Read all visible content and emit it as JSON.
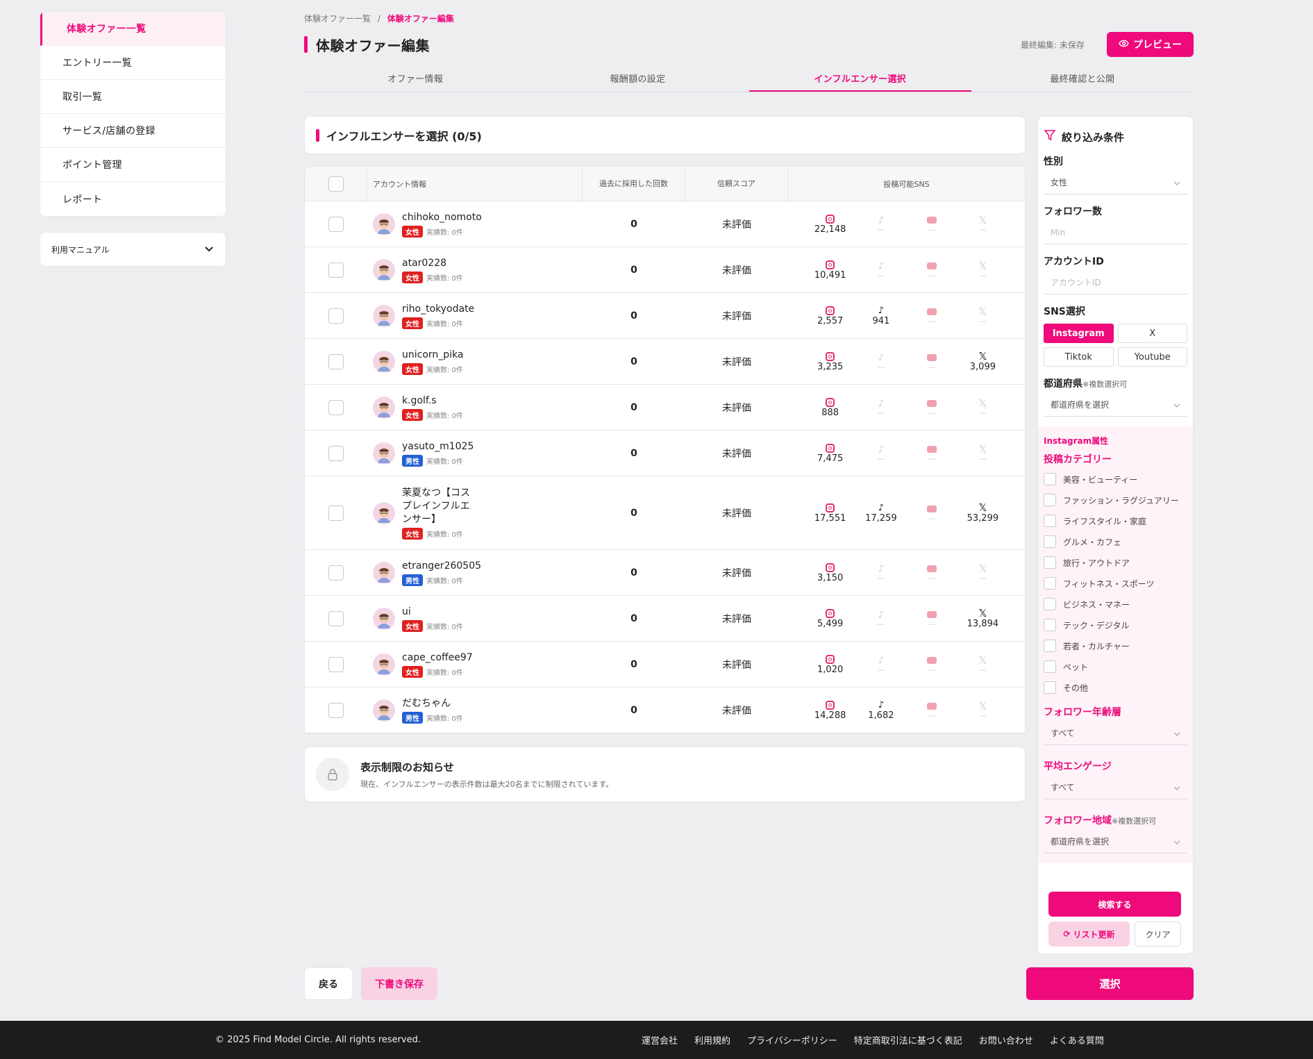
{
  "sidebar": {
    "items": [
      {
        "label": "体験オファー一覧",
        "active": true
      },
      {
        "label": "エントリー一覧"
      },
      {
        "label": "取引一覧"
      },
      {
        "label": "サービス/店舗の登録"
      },
      {
        "label": "ポイント管理"
      },
      {
        "label": "レポート"
      }
    ],
    "manual": "利用マニュアル"
  },
  "breadcrumb": {
    "parent": "体験オファー一覧",
    "sep": "/",
    "current": "体験オファー編集"
  },
  "page": {
    "title": "体験オファー編集",
    "last_edit": "最終編集: 未保存",
    "preview": "プレビュー"
  },
  "tabs": [
    "オファー情報",
    "報酬額の設定",
    "インフルエンサー選択",
    "最終確認と公開"
  ],
  "section_title": "インフルエンサーを選択 (0/5)",
  "table": {
    "headers": {
      "account": "アカウント情報",
      "count": "過去に採用した回数",
      "score": "信頼スコア",
      "sns": "投稿可能SNS"
    },
    "rows": [
      {
        "name": "chihoko_nomoto",
        "gender": "女性",
        "g": "f",
        "meta": "実績数: 0件",
        "count": "0",
        "score": "未評価",
        "ig": "22,148",
        "tt": "",
        "yt": "",
        "x": ""
      },
      {
        "name": "atar0228",
        "gender": "女性",
        "g": "f",
        "meta": "実績数: 0件",
        "count": "0",
        "score": "未評価",
        "ig": "10,491",
        "tt": "",
        "yt": "",
        "x": ""
      },
      {
        "name": "riho_tokyodate",
        "gender": "女性",
        "g": "f",
        "meta": "実績数: 0件",
        "count": "0",
        "score": "未評価",
        "ig": "2,557",
        "tt": "941",
        "yt": "",
        "x": ""
      },
      {
        "name": "unicorn_pika",
        "gender": "女性",
        "g": "f",
        "meta": "実績数: 0件",
        "count": "0",
        "score": "未評価",
        "ig": "3,235",
        "tt": "",
        "yt": "",
        "x": "3,099"
      },
      {
        "name": "k.golf.s",
        "gender": "女性",
        "g": "f",
        "meta": "実績数: 0件",
        "count": "0",
        "score": "未評価",
        "ig": "888",
        "tt": "",
        "yt": "",
        "x": ""
      },
      {
        "name": "yasuto_m1025",
        "gender": "男性",
        "g": "m",
        "meta": "実績数: 0件",
        "count": "0",
        "score": "未評価",
        "ig": "7,475",
        "tt": "",
        "yt": "",
        "x": ""
      },
      {
        "name": "茉夏なつ【コスプレインフルエンサー】",
        "gender": "女性",
        "g": "f",
        "meta": "実績数: 0件",
        "count": "0",
        "score": "未評価",
        "ig": "17,551",
        "tt": "17,259",
        "yt": "",
        "x": "53,299"
      },
      {
        "name": "etranger260505",
        "gender": "男性",
        "g": "m",
        "meta": "実績数: 0件",
        "count": "0",
        "score": "未評価",
        "ig": "3,150",
        "tt": "",
        "yt": "",
        "x": ""
      },
      {
        "name": "ui",
        "gender": "女性",
        "g": "f",
        "meta": "実績数: 0件",
        "count": "0",
        "score": "未評価",
        "ig": "5,499",
        "tt": "",
        "yt": "",
        "x": "13,894"
      },
      {
        "name": "cape_coffee97",
        "gender": "女性",
        "g": "f",
        "meta": "実績数: 0件",
        "count": "0",
        "score": "未評価",
        "ig": "1,020",
        "tt": "",
        "yt": "",
        "x": ""
      },
      {
        "name": "だむちゃん",
        "gender": "男性",
        "g": "m",
        "meta": "実績数: 0件",
        "count": "0",
        "score": "未評価",
        "ig": "14,288",
        "tt": "1,682",
        "yt": "",
        "x": ""
      }
    ]
  },
  "notice": {
    "title": "表示制限のお知らせ",
    "body": "現在、インフルエンサーの表示件数は最大20名までに制限されています。"
  },
  "filter": {
    "title": "絞り込み条件",
    "gender_label": "性別",
    "gender_value": "女性",
    "followers_label": "フォロワー数",
    "followers_placeholder": "Min",
    "account_label": "アカウントID",
    "account_placeholder": "アカウントID",
    "sns_label": "SNS選択",
    "sns": [
      "Instagram",
      "X",
      "Tiktok",
      "Youtube"
    ],
    "pref_label": "都道府県",
    "pref_note": "※複数選択可",
    "pref_placeholder": "都道府県を選択",
    "ig_title": "Instagram属性",
    "cat_label": "投稿カテゴリー",
    "categories": [
      "美容・ビューティー",
      "ファッション・ラグジュアリー",
      "ライフスタイル・家庭",
      "グルメ・カフェ",
      "旅行・アウトドア",
      "フィットネス・スポーツ",
      "ビジネス・マネー",
      "テック・デジタル",
      "若者・カルチャー",
      "ペット",
      "その他"
    ],
    "age_label": "フォロワー年齢層",
    "age_value": "すべて",
    "eng_label": "平均エンゲージ",
    "eng_value": "すべて",
    "region_label": "フォロワー地域",
    "region_note": "※複数選択可",
    "region_placeholder": "都道府県を選択",
    "search": "検索する",
    "refresh": "リスト更新",
    "clear": "クリア"
  },
  "actions": {
    "back": "戻る",
    "draft": "下書き保存",
    "select": "選択"
  },
  "footer": {
    "copyright": "© 2025 Find Model Circle. All rights reserved.",
    "links": [
      "運営会社",
      "利用規約",
      "プライバシーポリシー",
      "特定商取引法に基づく表記",
      "お問い合わせ",
      "よくある質問"
    ]
  },
  "colors": {
    "accent": "#ee0a7b"
  }
}
